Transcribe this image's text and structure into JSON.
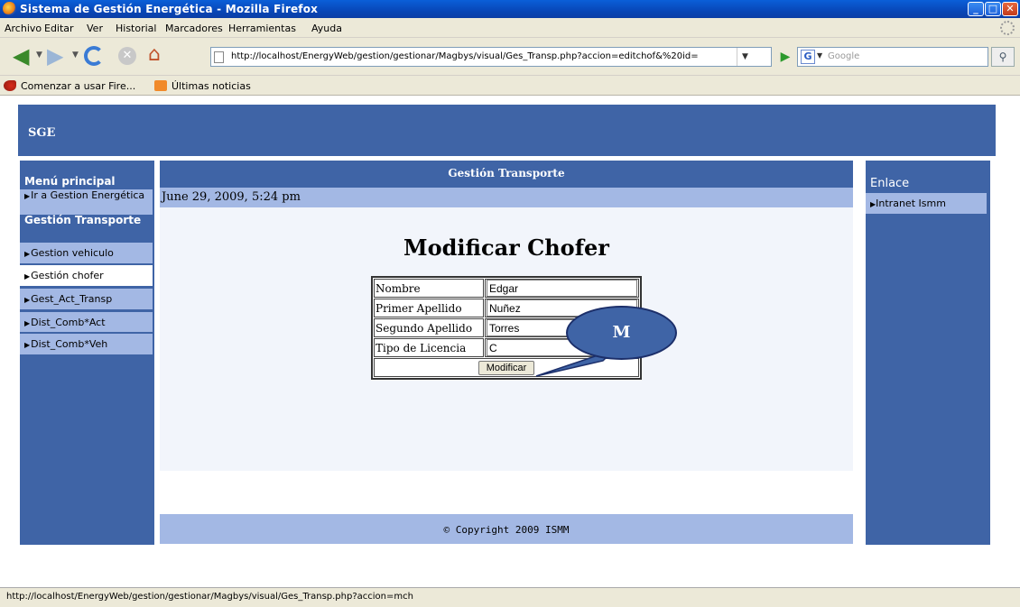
{
  "window": {
    "title": "Sistema de Gestión Energética - Mozilla Firefox"
  },
  "menubar": [
    "Archivo",
    "Editar",
    "Ver",
    "Historial",
    "Marcadores",
    "Herramientas",
    "Ayuda"
  ],
  "navbar": {
    "url": "http://localhost/EnergyWeb/gestion/gestionar/Magbys/visual/Ges_Transp.php?accion=editchof&%20id=",
    "search_placeholder": "Google"
  },
  "bookmarks": [
    "Comenzar a usar Fire...",
    "Últimas noticias"
  ],
  "page": {
    "brand": "SGE",
    "left_menu": {
      "title": "Menú principal",
      "items_top": [
        {
          "label": "Ir a Gestion Energética"
        }
      ],
      "section_title": "Gestión Transporte",
      "items": [
        {
          "label": "Gestion vehiculo"
        },
        {
          "label": "Gestión chofer"
        },
        {
          "label": "Gest_Act_Transp"
        },
        {
          "label": "Dist_Comb*Act"
        },
        {
          "label": "Dist_Comb*Veh"
        }
      ]
    },
    "section_header": "Gestión Transporte",
    "date": "June 29, 2009, 5:24 pm",
    "form_title": "Modificar Chofer",
    "form": {
      "rows": [
        {
          "label": "Nombre",
          "value": "Edgar"
        },
        {
          "label": "Primer Apellido",
          "value": "Nuñez"
        },
        {
          "label": "Segundo Apellido",
          "value": "Torres"
        },
        {
          "label": "Tipo de Licencia",
          "value": "C"
        }
      ],
      "submit_label": "Modificar"
    },
    "footer": "© Copyright 2009 ISMM",
    "right_menu": {
      "title": "Enlace",
      "items": [
        {
          "label": "Intranet Ismm"
        }
      ]
    }
  },
  "callout": {
    "label": "M"
  },
  "status": {
    "text": "http://localhost/EnergyWeb/gestion/gestionar/Magbys/visual/Ges_Transp.php?accion=mch"
  }
}
